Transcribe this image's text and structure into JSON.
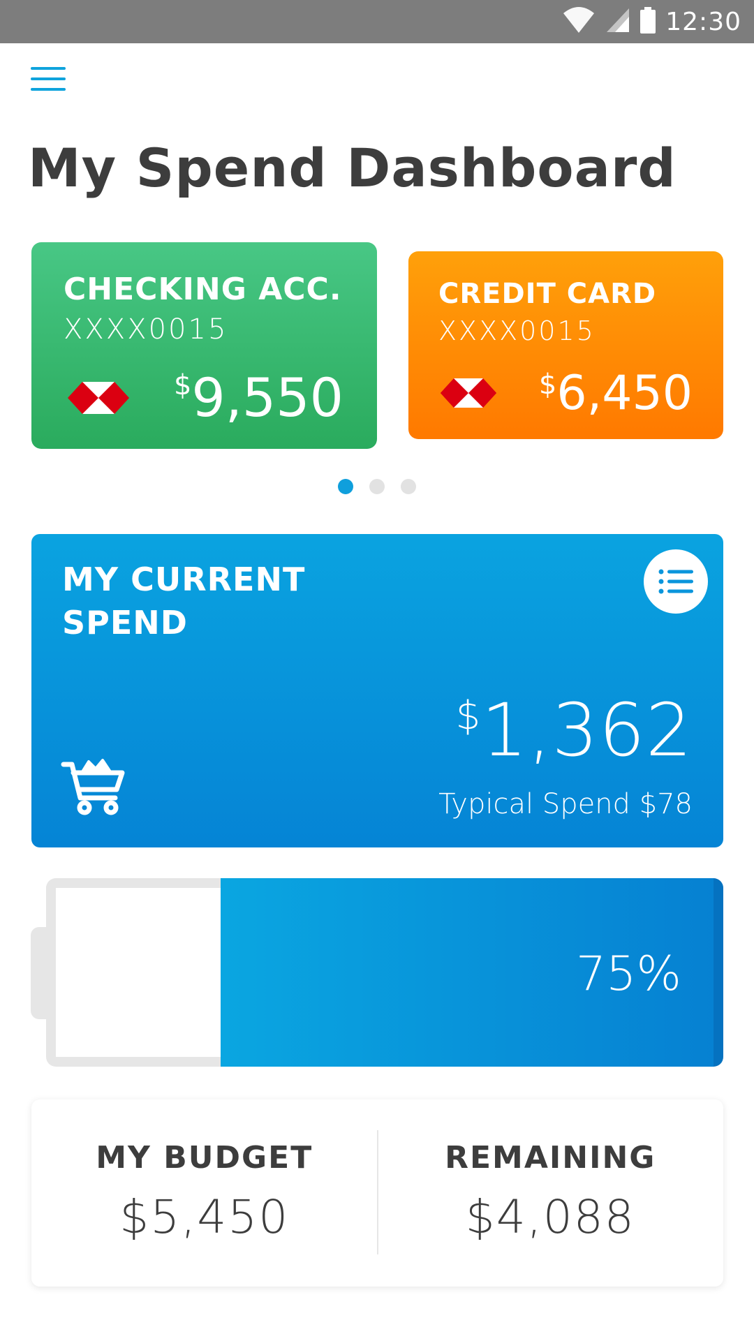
{
  "status_bar": {
    "time": "12:30",
    "icons": [
      "wifi-icon",
      "cellular-icon",
      "battery-icon"
    ]
  },
  "header": {
    "menu_icon": "hamburger-menu-icon",
    "title": "My Spend Dashboard"
  },
  "accounts": [
    {
      "name": "CHECKING ACC.",
      "number": "XXXX0015",
      "currency": "$",
      "balance": "9,550",
      "color_top": "#48c785",
      "color_bottom": "#2aab5d",
      "logo": "bank-hexagon-logo"
    },
    {
      "name": "CREDIT CARD",
      "number": "XXXX0015",
      "currency": "$",
      "balance": "6,450",
      "color_top": "#ffa00a",
      "color_bottom": "#ff7900",
      "logo": "bank-hexagon-logo"
    }
  ],
  "carousel": {
    "pages": 3,
    "active_index": 0,
    "active_color": "#0f9fdc"
  },
  "current_spend": {
    "title": "MY CURRENT SPEND",
    "currency": "$",
    "amount": "1,362",
    "typical": "Typical Spend $78",
    "icons": [
      "list-icon",
      "shopping-cart-icon"
    ],
    "color": "#0a95dc"
  },
  "budget_usage": {
    "percent_label": "75%",
    "fill_fraction": 0.75
  },
  "budget": {
    "budget_label": "MY BUDGET",
    "budget_value": "$5,450",
    "remaining_label": "REMAINING",
    "remaining_value": "$4,088"
  }
}
